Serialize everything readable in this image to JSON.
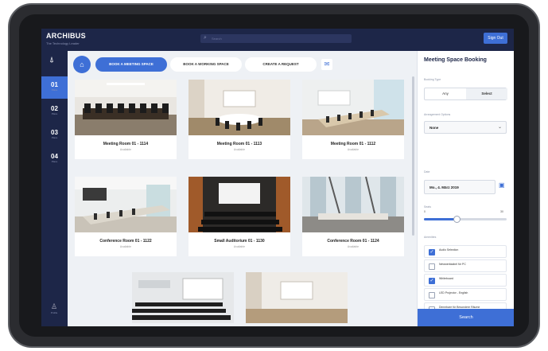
{
  "header": {
    "brand": "ARCHIBUS",
    "brand_sub": "The Technology Leader",
    "search_placeholder": "Search",
    "signout_label": "Sign Out"
  },
  "nav": {
    "items": [
      {
        "num": "01",
        "label": "Place"
      },
      {
        "num": "02",
        "label": "Place"
      },
      {
        "num": "03",
        "label": "Place"
      },
      {
        "num": "04",
        "label": "Place"
      }
    ],
    "user_label": "Profile"
  },
  "tabs": [
    {
      "label": "BOOK A MEETING SPACE"
    },
    {
      "label": "BOOK A WORKING SPACE"
    },
    {
      "label": "CREATE A REQUEST"
    }
  ],
  "rooms": [
    {
      "name": "Meeting Room 01 - 1114",
      "sub": "Available"
    },
    {
      "name": "Meeting Room 01 - 1113",
      "sub": "Available"
    },
    {
      "name": "Meeting Room 01 - 1112",
      "sub": "Available"
    },
    {
      "name": "Conference Room 01 - 1122",
      "sub": "Available"
    },
    {
      "name": "Small Auditorium 01 - 1130",
      "sub": "Available"
    },
    {
      "name": "Conference Room 01 - 1124",
      "sub": "Available"
    }
  ],
  "panel": {
    "title": "Meeting Space Booking",
    "booking_type_label": "Booking Type",
    "seg_left": "Any",
    "seg_right": "Select",
    "arrangement_label": "Arrangement Options",
    "arrangement_value": "None",
    "date_label": "Date",
    "date_value": "Mo., 4. März 2019",
    "seats_label": "Seats",
    "seats_min": "0",
    "seats_max": "30",
    "equipment_label": "Amenities",
    "checks": [
      {
        "label": "Audio Selection",
        "checked": true
      },
      {
        "label": "Netzwerkkabel für PC",
        "checked": false
      },
      {
        "label": "Whiteboard",
        "checked": true
      },
      {
        "label": "LED Projector - English",
        "checked": false
      },
      {
        "label": "Dimmbare für Besondere Räume",
        "checked": false
      }
    ],
    "search_label": "Search"
  }
}
